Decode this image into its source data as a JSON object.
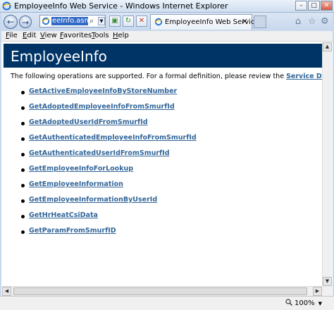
{
  "window": {
    "title": "EmployeeInfo Web Service - Windows Internet Explorer",
    "controls": [
      "–",
      "□",
      "✕"
    ]
  },
  "addressbar": {
    "value": "eeInfo.asmx"
  },
  "tab": {
    "label": "EmployeeInfo Web Service",
    "close": "✕"
  },
  "menu": {
    "items": [
      "File",
      "Edit",
      "View",
      "Favorites",
      "Tools",
      "Help"
    ]
  },
  "page": {
    "heading": "EmployeeInfo",
    "intro": "The following operations are supported. For a formal definition, please review the ",
    "intro_link": "Service Description",
    "intro_end": ".",
    "operations": [
      "GetActiveEmployeeInfoByStoreNumber",
      "GetAdoptedEmployeeInfoFromSmurfId",
      "GetAdoptedUserIdFromSmurfId",
      "GetAuthenticatedEmployeeInfoFromSmurfId",
      "GetAuthenticatedUserIdFromSmurfId",
      "GetEmployeeInfoForLookup",
      "GetEmployeeInformation",
      "GetEmployeeInformationByUserId",
      "GetHrHeatCsiData",
      "GetParamFromSmurfID"
    ]
  },
  "status": {
    "zoom": "100%"
  },
  "icons": {
    "back": "back-arrow-icon",
    "forward": "forward-arrow-icon",
    "refresh": "refresh-icon",
    "stop": "stop-icon",
    "home": "home-icon",
    "favorites": "star-icon",
    "tools": "gear-icon"
  },
  "colors": {
    "banner": "#003366",
    "link": "#336699",
    "selection": "#316ac5"
  }
}
